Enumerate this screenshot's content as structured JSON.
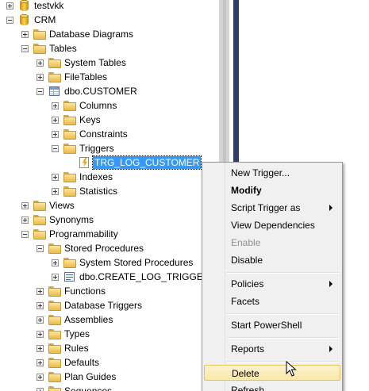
{
  "tree": {
    "nodes": [
      {
        "name": "tree-node-testvkk",
        "label": "testvkk",
        "expander": "plus",
        "icon": "database-icon"
      },
      {
        "name": "tree-node-crm",
        "label": "CRM",
        "expander": "minus",
        "icon": "database-icon"
      },
      {
        "name": "tree-node-database-diagrams",
        "label": "Database Diagrams",
        "expander": "plus",
        "icon": "folder-icon"
      },
      {
        "name": "tree-node-tables",
        "label": "Tables",
        "expander": "minus",
        "icon": "folder-icon"
      },
      {
        "name": "tree-node-system-tables",
        "label": "System Tables",
        "expander": "plus",
        "icon": "folder-icon"
      },
      {
        "name": "tree-node-filetables",
        "label": "FileTables",
        "expander": "plus",
        "icon": "folder-icon"
      },
      {
        "name": "tree-node-dbo-customer",
        "label": "dbo.CUSTOMER",
        "expander": "minus",
        "icon": "table-icon"
      },
      {
        "name": "tree-node-columns",
        "label": "Columns",
        "expander": "plus",
        "icon": "folder-icon"
      },
      {
        "name": "tree-node-keys",
        "label": "Keys",
        "expander": "plus",
        "icon": "folder-icon"
      },
      {
        "name": "tree-node-constraints",
        "label": "Constraints",
        "expander": "plus",
        "icon": "folder-icon"
      },
      {
        "name": "tree-node-triggers",
        "label": "Triggers",
        "expander": "minus",
        "icon": "folder-icon"
      },
      {
        "name": "tree-node-trg-log-customer",
        "label": "TRG_LOG_CUSTOMER",
        "expander": "none",
        "icon": "trigger-icon",
        "selected": true
      },
      {
        "name": "tree-node-indexes",
        "label": "Indexes",
        "expander": "plus",
        "icon": "folder-icon"
      },
      {
        "name": "tree-node-statistics",
        "label": "Statistics",
        "expander": "plus",
        "icon": "folder-icon"
      },
      {
        "name": "tree-node-views",
        "label": "Views",
        "expander": "plus",
        "icon": "folder-icon"
      },
      {
        "name": "tree-node-synonyms",
        "label": "Synonyms",
        "expander": "plus",
        "icon": "folder-icon"
      },
      {
        "name": "tree-node-programmability",
        "label": "Programmability",
        "expander": "minus",
        "icon": "folder-icon"
      },
      {
        "name": "tree-node-stored-procedures",
        "label": "Stored Procedures",
        "expander": "minus",
        "icon": "folder-icon"
      },
      {
        "name": "tree-node-system-stored-procedures",
        "label": "System Stored Procedures",
        "expander": "plus",
        "icon": "folder-icon"
      },
      {
        "name": "tree-node-dbo-create-log-trigger",
        "label": "dbo.CREATE_LOG_TRIGGE",
        "expander": "plus",
        "icon": "procedure-icon"
      },
      {
        "name": "tree-node-functions",
        "label": "Functions",
        "expander": "plus",
        "icon": "folder-icon"
      },
      {
        "name": "tree-node-database-triggers",
        "label": "Database Triggers",
        "expander": "plus",
        "icon": "folder-icon"
      },
      {
        "name": "tree-node-assemblies",
        "label": "Assemblies",
        "expander": "plus",
        "icon": "folder-icon"
      },
      {
        "name": "tree-node-types",
        "label": "Types",
        "expander": "plus",
        "icon": "folder-icon"
      },
      {
        "name": "tree-node-rules",
        "label": "Rules",
        "expander": "plus",
        "icon": "folder-icon"
      },
      {
        "name": "tree-node-defaults",
        "label": "Defaults",
        "expander": "plus",
        "icon": "folder-icon"
      },
      {
        "name": "tree-node-plan-guides",
        "label": "Plan Guides",
        "expander": "plus",
        "icon": "folder-icon"
      },
      {
        "name": "tree-node-sequences",
        "label": "Sequences",
        "expander": "plus",
        "icon": "folder-icon"
      }
    ]
  },
  "context_menu": {
    "items": [
      {
        "name": "menu-item-new-trigger",
        "label": "New Trigger...",
        "type": "item"
      },
      {
        "name": "menu-item-modify",
        "label": "Modify",
        "type": "item",
        "bold": true
      },
      {
        "name": "menu-item-script-trigger-as",
        "label": "Script Trigger as",
        "type": "item",
        "submenu": true
      },
      {
        "name": "menu-item-view-dependencies",
        "label": "View Dependencies",
        "type": "item"
      },
      {
        "name": "menu-item-enable",
        "label": "Enable",
        "type": "item",
        "disabled": true
      },
      {
        "name": "menu-item-disable",
        "label": "Disable",
        "type": "item"
      },
      {
        "type": "separator"
      },
      {
        "name": "menu-item-policies",
        "label": "Policies",
        "type": "item",
        "submenu": true
      },
      {
        "name": "menu-item-facets",
        "label": "Facets",
        "type": "item"
      },
      {
        "type": "separator"
      },
      {
        "name": "menu-item-start-powershell",
        "label": "Start PowerShell",
        "type": "item"
      },
      {
        "type": "separator"
      },
      {
        "name": "menu-item-reports",
        "label": "Reports",
        "type": "item",
        "submenu": true
      },
      {
        "type": "separator"
      },
      {
        "name": "menu-item-delete",
        "label": "Delete",
        "type": "item",
        "highlighted": true
      },
      {
        "name": "menu-item-refresh",
        "label": "Refresh",
        "type": "item"
      }
    ]
  },
  "colors": {
    "selection": "#3399ff",
    "menu_highlight": "#fae8a6",
    "divider": "#2e3d6b"
  }
}
